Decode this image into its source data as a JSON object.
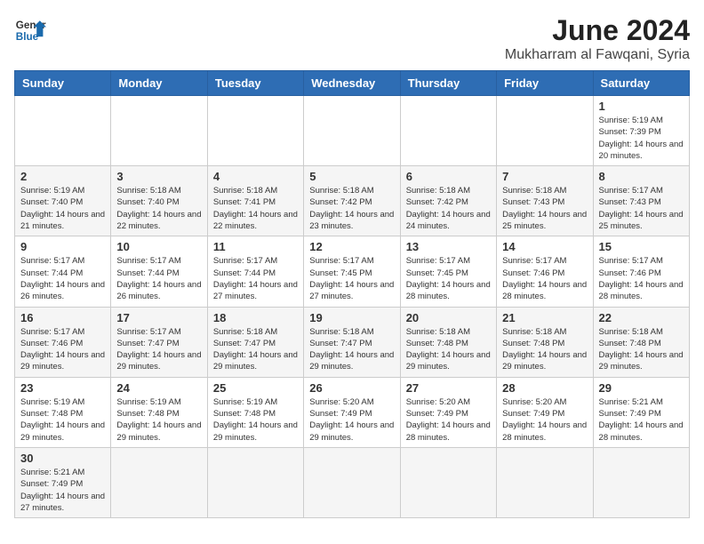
{
  "logo": {
    "general": "General",
    "blue": "Blue"
  },
  "header": {
    "month": "June 2024",
    "location": "Mukharram al Fawqani, Syria"
  },
  "weekdays": [
    "Sunday",
    "Monday",
    "Tuesday",
    "Wednesday",
    "Thursday",
    "Friday",
    "Saturday"
  ],
  "weeks": [
    [
      {
        "day": "",
        "info": ""
      },
      {
        "day": "",
        "info": ""
      },
      {
        "day": "",
        "info": ""
      },
      {
        "day": "",
        "info": ""
      },
      {
        "day": "",
        "info": ""
      },
      {
        "day": "",
        "info": ""
      },
      {
        "day": "1",
        "info": "Sunrise: 5:19 AM\nSunset: 7:39 PM\nDaylight: 14 hours and 20 minutes."
      }
    ],
    [
      {
        "day": "2",
        "info": "Sunrise: 5:19 AM\nSunset: 7:40 PM\nDaylight: 14 hours and 21 minutes."
      },
      {
        "day": "3",
        "info": "Sunrise: 5:18 AM\nSunset: 7:40 PM\nDaylight: 14 hours and 22 minutes."
      },
      {
        "day": "4",
        "info": "Sunrise: 5:18 AM\nSunset: 7:41 PM\nDaylight: 14 hours and 22 minutes."
      },
      {
        "day": "5",
        "info": "Sunrise: 5:18 AM\nSunset: 7:42 PM\nDaylight: 14 hours and 23 minutes."
      },
      {
        "day": "6",
        "info": "Sunrise: 5:18 AM\nSunset: 7:42 PM\nDaylight: 14 hours and 24 minutes."
      },
      {
        "day": "7",
        "info": "Sunrise: 5:18 AM\nSunset: 7:43 PM\nDaylight: 14 hours and 25 minutes."
      },
      {
        "day": "8",
        "info": "Sunrise: 5:17 AM\nSunset: 7:43 PM\nDaylight: 14 hours and 25 minutes."
      }
    ],
    [
      {
        "day": "9",
        "info": "Sunrise: 5:17 AM\nSunset: 7:44 PM\nDaylight: 14 hours and 26 minutes."
      },
      {
        "day": "10",
        "info": "Sunrise: 5:17 AM\nSunset: 7:44 PM\nDaylight: 14 hours and 26 minutes."
      },
      {
        "day": "11",
        "info": "Sunrise: 5:17 AM\nSunset: 7:44 PM\nDaylight: 14 hours and 27 minutes."
      },
      {
        "day": "12",
        "info": "Sunrise: 5:17 AM\nSunset: 7:45 PM\nDaylight: 14 hours and 27 minutes."
      },
      {
        "day": "13",
        "info": "Sunrise: 5:17 AM\nSunset: 7:45 PM\nDaylight: 14 hours and 28 minutes."
      },
      {
        "day": "14",
        "info": "Sunrise: 5:17 AM\nSunset: 7:46 PM\nDaylight: 14 hours and 28 minutes."
      },
      {
        "day": "15",
        "info": "Sunrise: 5:17 AM\nSunset: 7:46 PM\nDaylight: 14 hours and 28 minutes."
      }
    ],
    [
      {
        "day": "16",
        "info": "Sunrise: 5:17 AM\nSunset: 7:46 PM\nDaylight: 14 hours and 29 minutes."
      },
      {
        "day": "17",
        "info": "Sunrise: 5:17 AM\nSunset: 7:47 PM\nDaylight: 14 hours and 29 minutes."
      },
      {
        "day": "18",
        "info": "Sunrise: 5:18 AM\nSunset: 7:47 PM\nDaylight: 14 hours and 29 minutes."
      },
      {
        "day": "19",
        "info": "Sunrise: 5:18 AM\nSunset: 7:47 PM\nDaylight: 14 hours and 29 minutes."
      },
      {
        "day": "20",
        "info": "Sunrise: 5:18 AM\nSunset: 7:48 PM\nDaylight: 14 hours and 29 minutes."
      },
      {
        "day": "21",
        "info": "Sunrise: 5:18 AM\nSunset: 7:48 PM\nDaylight: 14 hours and 29 minutes."
      },
      {
        "day": "22",
        "info": "Sunrise: 5:18 AM\nSunset: 7:48 PM\nDaylight: 14 hours and 29 minutes."
      }
    ],
    [
      {
        "day": "23",
        "info": "Sunrise: 5:19 AM\nSunset: 7:48 PM\nDaylight: 14 hours and 29 minutes."
      },
      {
        "day": "24",
        "info": "Sunrise: 5:19 AM\nSunset: 7:48 PM\nDaylight: 14 hours and 29 minutes."
      },
      {
        "day": "25",
        "info": "Sunrise: 5:19 AM\nSunset: 7:48 PM\nDaylight: 14 hours and 29 minutes."
      },
      {
        "day": "26",
        "info": "Sunrise: 5:20 AM\nSunset: 7:49 PM\nDaylight: 14 hours and 29 minutes."
      },
      {
        "day": "27",
        "info": "Sunrise: 5:20 AM\nSunset: 7:49 PM\nDaylight: 14 hours and 28 minutes."
      },
      {
        "day": "28",
        "info": "Sunrise: 5:20 AM\nSunset: 7:49 PM\nDaylight: 14 hours and 28 minutes."
      },
      {
        "day": "29",
        "info": "Sunrise: 5:21 AM\nSunset: 7:49 PM\nDaylight: 14 hours and 28 minutes."
      }
    ],
    [
      {
        "day": "30",
        "info": "Sunrise: 5:21 AM\nSunset: 7:49 PM\nDaylight: 14 hours and 27 minutes."
      },
      {
        "day": "",
        "info": ""
      },
      {
        "day": "",
        "info": ""
      },
      {
        "day": "",
        "info": ""
      },
      {
        "day": "",
        "info": ""
      },
      {
        "day": "",
        "info": ""
      },
      {
        "day": "",
        "info": ""
      }
    ]
  ]
}
